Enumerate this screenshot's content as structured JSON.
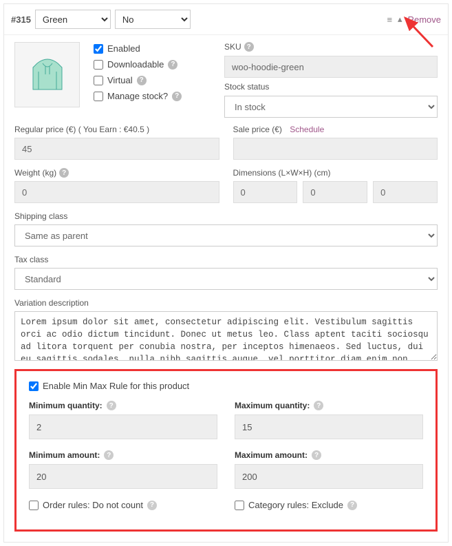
{
  "variation": {
    "id": "#315",
    "attr1": "Green",
    "attr2": "No",
    "remove": "Remove"
  },
  "checks": {
    "enabled": "Enabled",
    "downloadable": "Downloadable",
    "virtual": "Virtual",
    "manage_stock": "Manage stock?"
  },
  "sku": {
    "label": "SKU",
    "value": "woo-hoodie-green"
  },
  "stock": {
    "label": "Stock status",
    "value": "In stock"
  },
  "price": {
    "regular_label": "Regular price (€) ( You Earn : €40.5 )",
    "regular_value": "45",
    "sale_label": "Sale price (€)",
    "schedule": "Schedule"
  },
  "weight": {
    "label": "Weight (kg)",
    "value": "0"
  },
  "dims": {
    "label": "Dimensions (L×W×H) (cm)",
    "l": "0",
    "w": "0",
    "h": "0"
  },
  "shipping": {
    "label": "Shipping class",
    "value": "Same as parent"
  },
  "tax": {
    "label": "Tax class",
    "value": "Standard"
  },
  "desc": {
    "label": "Variation description",
    "value": "Lorem ipsum dolor sit amet, consectetur adipiscing elit. Vestibulum sagittis orci ac odio dictum tincidunt. Donec ut metus leo. Class aptent taciti sociosqu ad litora torquent per conubia nostra, per inceptos himenaeos. Sed luctus, dui eu sagittis sodales, nulla nibh sagittis augue, vel porttitor diam enim non metus. Vestibulum aliquam augue neque. Phasellus tincidunt odio eget ullamcorper efficitur. Cras placerat ut"
  },
  "minmax": {
    "enable_label": "Enable Min Max Rule for this product",
    "min_qty_label": "Minimum quantity:",
    "min_qty": "2",
    "max_qty_label": "Maximum quantity:",
    "max_qty": "15",
    "min_amt_label": "Minimum amount:",
    "min_amt": "20",
    "max_amt_label": "Maximum amount:",
    "max_amt": "200",
    "order_rules": "Order rules: Do not count",
    "category_rules": "Category rules: Exclude"
  }
}
